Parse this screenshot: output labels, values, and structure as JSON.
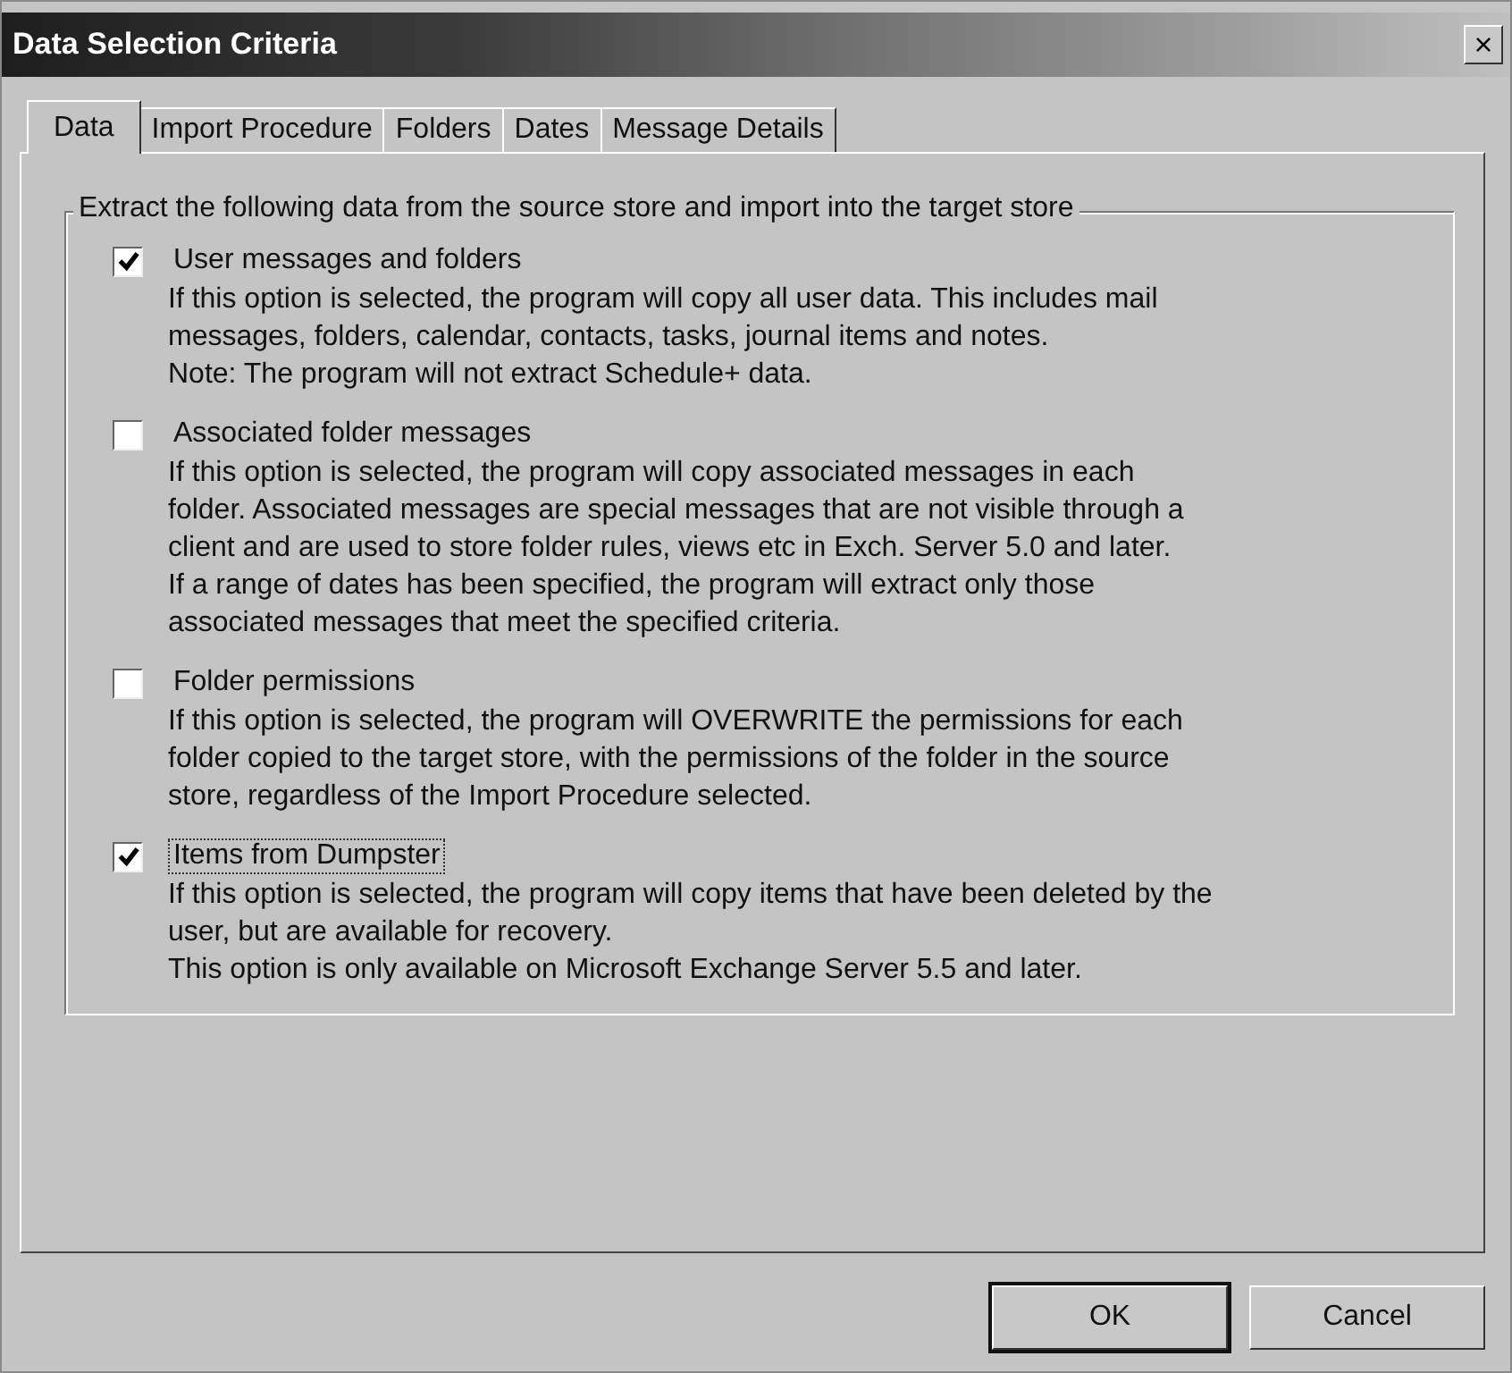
{
  "window": {
    "title": "Data Selection Criteria",
    "close": "×"
  },
  "tabs": [
    {
      "label": "Data",
      "selected": true
    },
    {
      "label": "Import Procedure",
      "selected": false
    },
    {
      "label": "Folders",
      "selected": false
    },
    {
      "label": "Dates",
      "selected": false
    },
    {
      "label": "Message Details",
      "selected": false
    }
  ],
  "group": {
    "title": "Extract the following data from the source store and import into the target store",
    "options": [
      {
        "label": "User messages and folders",
        "checked": true,
        "focused": false,
        "description": [
          "If this option is selected, the program will copy all user data. This includes mail",
          "messages, folders, calendar, contacts, tasks, journal items and notes.",
          "Note: The program will not extract Schedule+ data."
        ]
      },
      {
        "label": "Associated folder messages",
        "checked": false,
        "focused": false,
        "description": [
          "If this option is selected, the program will copy associated messages in each",
          "folder. Associated messages are special messages that are not visible through a",
          "client and are used to store folder rules, views etc in Exch. Server 5.0 and later.",
          "If a range of dates has been specified, the program will extract only those",
          "associated messages that meet the specified criteria."
        ]
      },
      {
        "label": "Folder permissions",
        "checked": false,
        "focused": false,
        "description": [
          "If this option is selected, the program will OVERWRITE the permissions for each",
          "folder copied to the target store, with the permissions of the folder in the source",
          "store, regardless of the Import Procedure selected."
        ]
      },
      {
        "label": "Items from Dumpster",
        "checked": true,
        "focused": true,
        "description": [
          "If this option is selected, the program will copy items that have been deleted by the",
          "user, but are available for recovery.",
          "This option is only available on Microsoft Exchange Server 5.5 and later."
        ]
      }
    ]
  },
  "buttons": [
    {
      "label": "OK",
      "default": true
    },
    {
      "label": "Cancel",
      "default": false
    }
  ]
}
